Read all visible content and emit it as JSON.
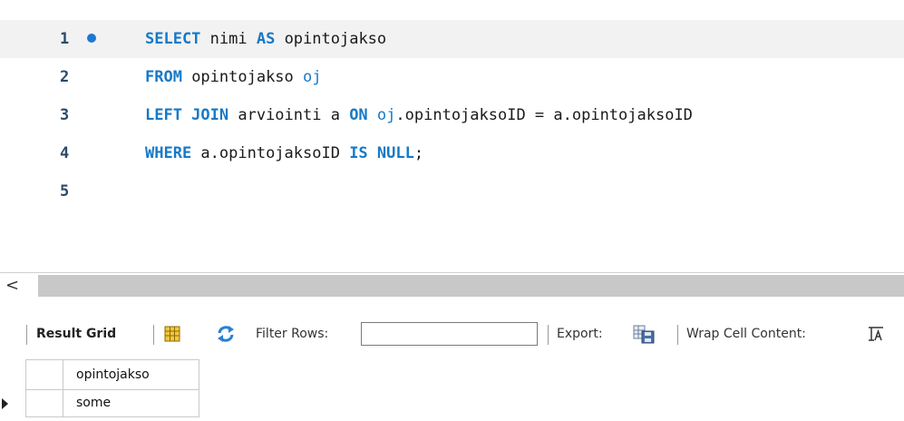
{
  "editor": {
    "lines": [
      {
        "number": "1",
        "tokens": [
          {
            "t": "SELECT",
            "c": "kw"
          },
          {
            "t": " nimi ",
            "c": ""
          },
          {
            "t": "AS",
            "c": "kw"
          },
          {
            "t": " opintojakso",
            "c": ""
          }
        ]
      },
      {
        "number": "2",
        "tokens": [
          {
            "t": "FROM",
            "c": "kw"
          },
          {
            "t": " opintojakso ",
            "c": ""
          },
          {
            "t": "oj",
            "c": "al"
          }
        ]
      },
      {
        "number": "3",
        "tokens": [
          {
            "t": "LEFT JOIN",
            "c": "kw"
          },
          {
            "t": " arviointi a ",
            "c": ""
          },
          {
            "t": "ON",
            "c": "kw"
          },
          {
            "t": " ",
            "c": ""
          },
          {
            "t": "oj",
            "c": "al"
          },
          {
            "t": ".opintojaksoID = a.opintojaksoID",
            "c": ""
          }
        ]
      },
      {
        "number": "4",
        "tokens": [
          {
            "t": "WHERE",
            "c": "kw"
          },
          {
            "t": " a.opintojaksoID ",
            "c": ""
          },
          {
            "t": "IS",
            "c": "kw"
          },
          {
            "t": " ",
            "c": ""
          },
          {
            "t": "NULL",
            "c": "kw"
          },
          {
            "t": ";",
            "c": ""
          }
        ]
      },
      {
        "number": "5",
        "tokens": []
      }
    ]
  },
  "scrollbar": {
    "left_arrow": "<"
  },
  "toolbar": {
    "result_grid_label": "Result Grid",
    "filter_rows_label": "Filter Rows:",
    "filter_rows_value": "",
    "export_label": "Export:",
    "wrap_label": "Wrap Cell Content:"
  },
  "grid": {
    "columns": [
      "opintojakso"
    ],
    "rows": [
      [
        "some"
      ]
    ]
  },
  "colors": {
    "keyword": "#1679c7",
    "line_number": "#2b4a6b",
    "breakpoint_dot": "#1e78d2"
  },
  "icons": [
    "grid-icon",
    "refresh-icon",
    "export-icon",
    "wrap-cell-icon",
    "row-pointer-icon"
  ]
}
